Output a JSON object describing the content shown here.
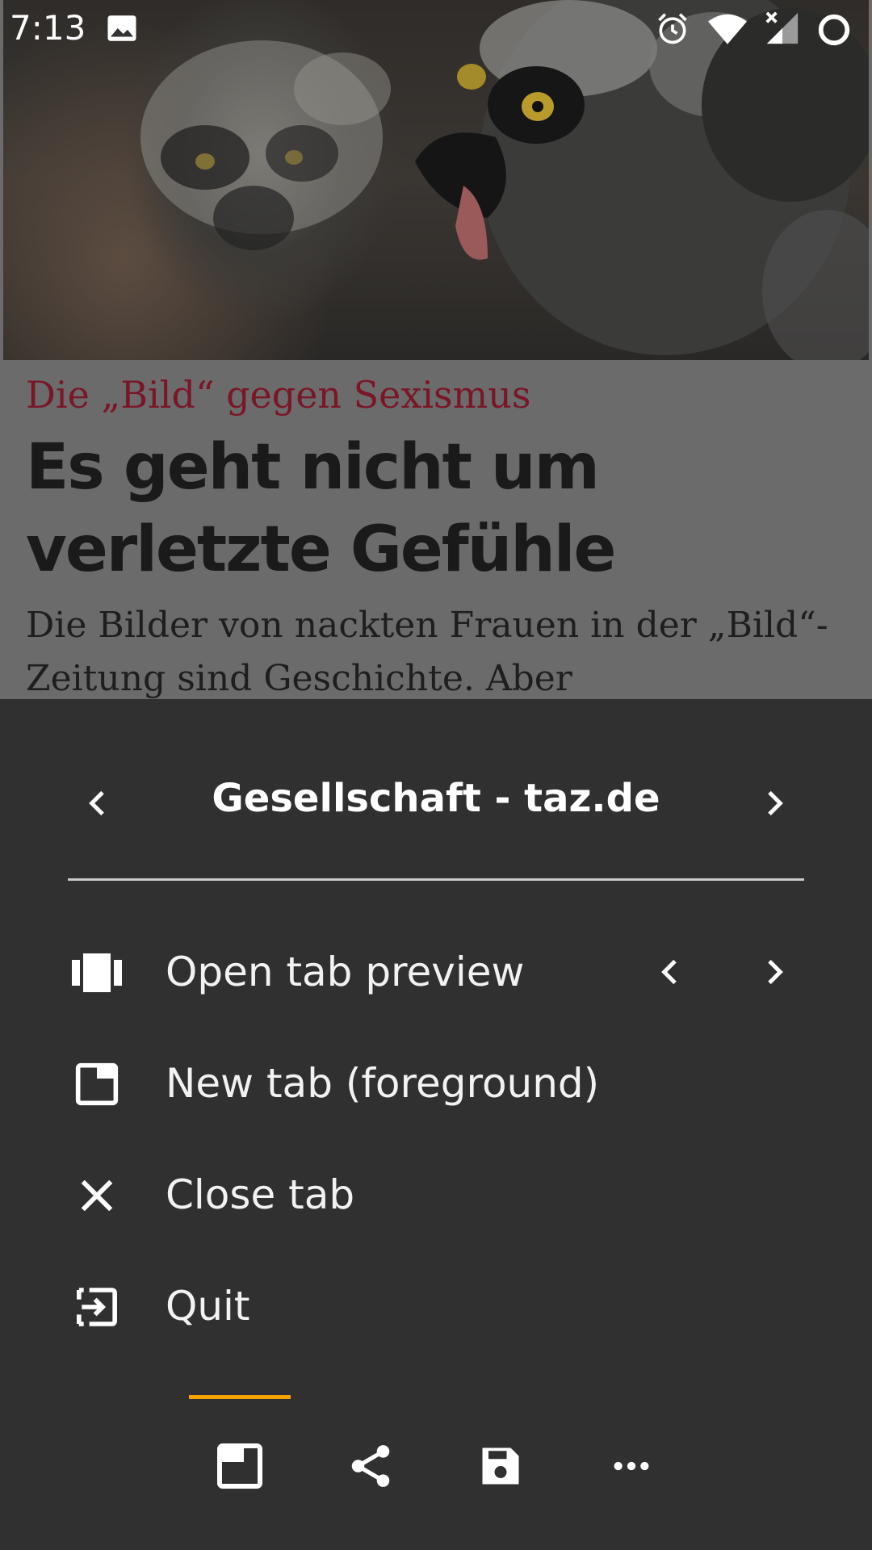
{
  "status_bar": {
    "time": "7:13",
    "icons": [
      "image-icon",
      "alarm-icon",
      "wifi-icon",
      "signal-no-service-icon",
      "sync-icon"
    ]
  },
  "article": {
    "kicker": "Die „Bild“ gegen Sexismus",
    "headline": "Es geht nicht um verletzte Gefühle",
    "lead": "Die Bilder von nackten Frauen in der „Bild“-Zeitung sind Geschichte. Aber"
  },
  "sheet": {
    "title": "Gesellschaft - taz.de",
    "menu_items": [
      {
        "label": "Open tab preview",
        "icon": "tab-preview-icon"
      },
      {
        "label": "New tab (foreground)",
        "icon": "new-tab-icon"
      },
      {
        "label": "Close tab",
        "icon": "close-icon"
      },
      {
        "label": "Quit",
        "icon": "exit-icon"
      }
    ],
    "bottom_bar": {
      "icons": [
        "tab-icon",
        "share-icon",
        "save-icon",
        "more-icon"
      ],
      "selected": "tab-icon"
    }
  },
  "colors": {
    "sheet_background": "#303030",
    "accent": "#f5a300",
    "kicker": "#7a1626",
    "divider": "#c9c9c9"
  }
}
